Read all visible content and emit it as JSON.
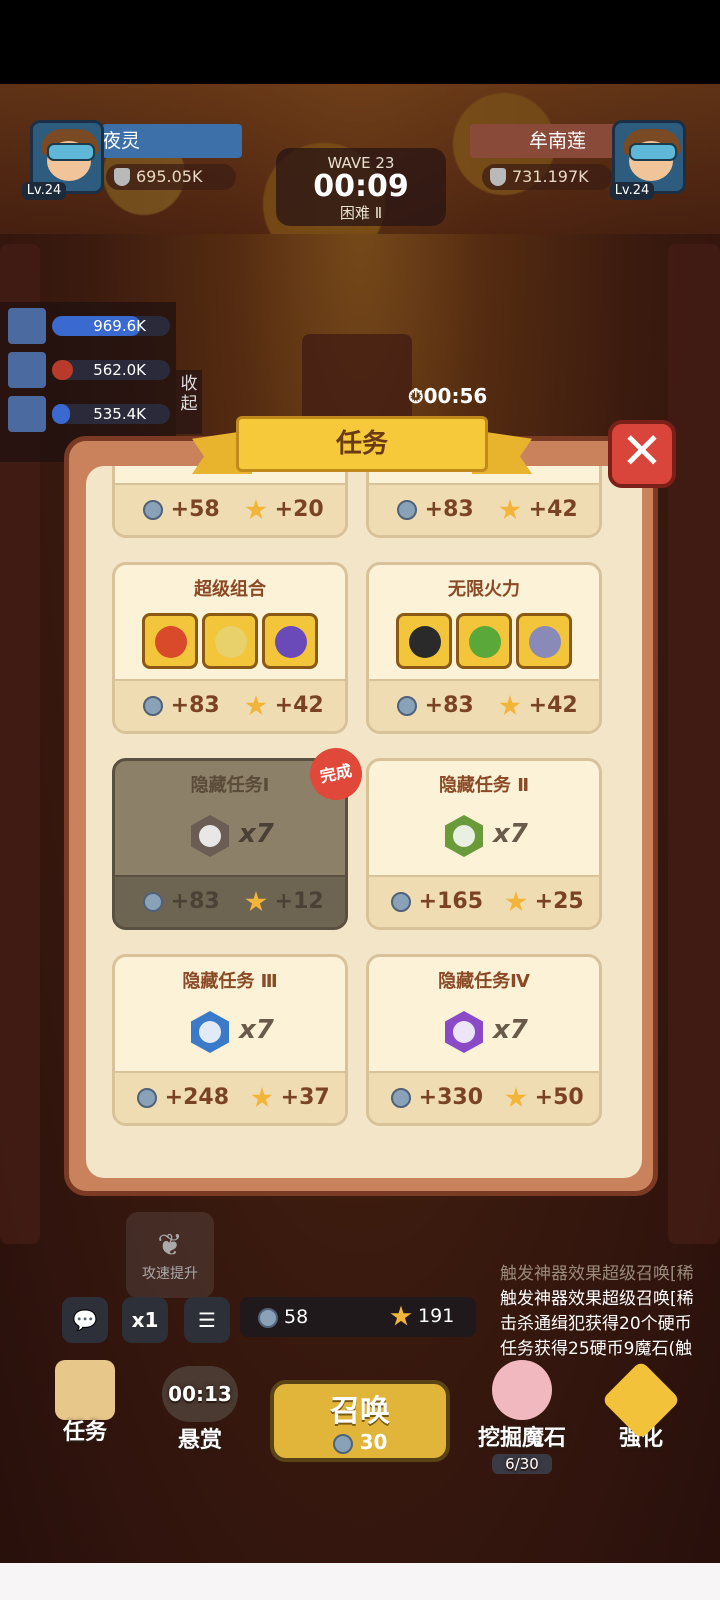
{
  "top": {
    "left_player": {
      "name": "夜灵",
      "level": "Lv.24",
      "power": "695.05K"
    },
    "right_player": {
      "name": "牟南莲",
      "level": "Lv.24",
      "power": "731.197K"
    },
    "wave": {
      "label": "WAVE 23",
      "time": "00:09",
      "difficulty": "困难 Ⅱ"
    }
  },
  "ranking": [
    {
      "value": "969.6K",
      "color": "#3a6ad0",
      "fill": 0.75
    },
    {
      "value": "562.0K",
      "color": "#b83a2a",
      "fill": 0.18
    },
    {
      "value": "535.4K",
      "color": "#3a6ad0",
      "fill": 0.15
    }
  ],
  "collapse_label": "收起",
  "side_timer": "00:56",
  "modal": {
    "title": "任务",
    "close_symbol": "✕",
    "partial_cards": [
      {
        "coins": "+58",
        "stars": "+20"
      },
      {
        "coins": "+83",
        "stars": "+42"
      }
    ],
    "cards": [
      {
        "title": "超级组合",
        "coins": "+83",
        "stars": "+42",
        "heroes": [
          "#d84a2a",
          "#e8d06a",
          "#6a4ab8"
        ]
      },
      {
        "title": "无限火力",
        "coins": "+83",
        "stars": "+42",
        "heroes": [
          "#2a2a2a",
          "#5aa83a",
          "#8a8ab8"
        ]
      },
      {
        "title": "隐藏任务Ⅰ",
        "gem_color": "#6a5e54",
        "count": "x7",
        "coins": "+83",
        "stars": "+12",
        "done": true
      },
      {
        "title": "隐藏任务 Ⅱ",
        "gem_color": "#6a9a3a",
        "count": "x7",
        "coins": "+165",
        "stars": "+25"
      },
      {
        "title": "隐藏任务 Ⅲ",
        "gem_color": "#3a7ac8",
        "count": "x7",
        "coins": "+248",
        "stars": "+37"
      },
      {
        "title": "隐藏任务Ⅳ",
        "gem_color": "#8a4ac8",
        "count": "x7",
        "coins": "+330",
        "stars": "+50"
      }
    ],
    "done_stamp": "完成"
  },
  "attack_boost": "攻速提升",
  "toolbar": {
    "chat_icon": "chat-icon",
    "speed": "x1",
    "menu_icon": "menu-icon",
    "coins": "58",
    "stars": "191"
  },
  "bottom": {
    "task": "任务",
    "bounty_time": "00:13",
    "bounty": "悬赏",
    "summon": "召唤",
    "summon_cost": "30",
    "dig": "挖掘魔石",
    "dig_progress": "6/30",
    "upgrade": "强化"
  },
  "log": [
    "触发神器效果超级召唤[稀",
    "触发神器效果超级召唤[稀",
    "击杀通缉犯获得20个硬币",
    "任务获得25硬币9魔石(触"
  ]
}
